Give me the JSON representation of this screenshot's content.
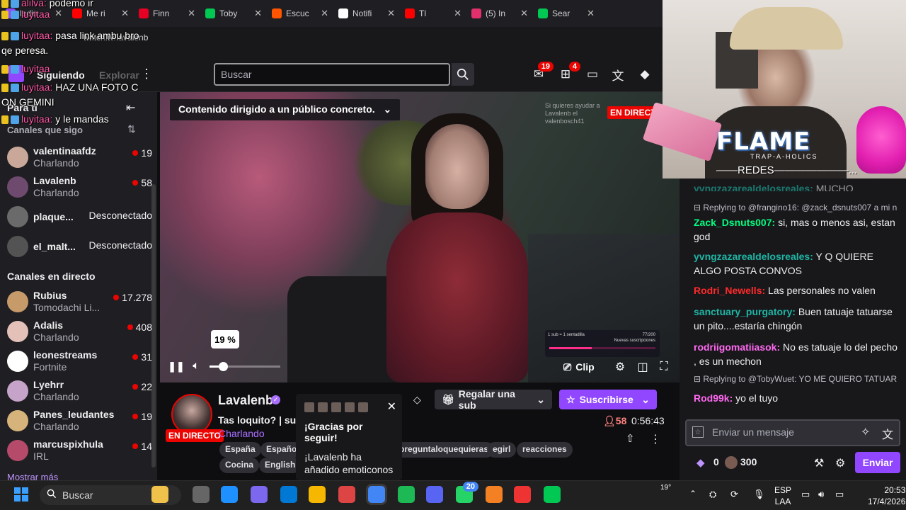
{
  "browser": {
    "tabs": [
      {
        "label": "ladin",
        "color": "#9147ff"
      },
      {
        "label": "Me ri",
        "color": "#ff0000"
      },
      {
        "label": "Finn",
        "color": "#e60023"
      },
      {
        "label": "Toby",
        "color": "#00c853"
      },
      {
        "label": "Escuc",
        "color": "#ff5500"
      },
      {
        "label": "Notifi",
        "color": "#ffffff"
      },
      {
        "label": "Tl",
        "color": "#ff0000"
      },
      {
        "label": "(5) In",
        "color": "#e1306c"
      },
      {
        "label": "Sear",
        "color": "#00c853"
      }
    ],
    "address": "twitch.tv/lavalenb"
  },
  "header": {
    "search_placeholder": "Buscar",
    "notifications_count": "19",
    "inbox_count": "4",
    "following_label": "Siguiendo",
    "browse_label": "Explorar"
  },
  "overlay_chat": [
    {
      "user": "alilva:",
      "text": "podemo ir"
    },
    {
      "user": "luyitaa",
      "text": ""
    },
    {
      "user": "luyitaa:",
      "text": "pasa link ambu bro"
    },
    {
      "user": "",
      "text": "qe peresa."
    },
    {
      "user": "luyitaa",
      "text": ""
    },
    {
      "user": "luyitaa:",
      "text": "HAZ UNA FOTO C"
    },
    {
      "user": "",
      "text": "ON GEMINI"
    },
    {
      "user": "luyitaa:",
      "text": "y le mandas"
    }
  ],
  "sidebar": {
    "for_you": "Para ti",
    "followed_title": "Canales que sigo",
    "followed": [
      {
        "name": "valentinaafdz",
        "sub": "Charlando",
        "viewers": "19",
        "online": true
      },
      {
        "name": "Lavalenb",
        "sub": "Charlando",
        "viewers": "58",
        "online": true
      },
      {
        "name": "plaque...",
        "sub": "",
        "status": "Desconectado",
        "online": false
      },
      {
        "name": "el_malt...",
        "sub": "",
        "status": "Desconectado",
        "online": false
      }
    ],
    "live_title": "Canales en directo",
    "live": [
      {
        "name": "Rubius",
        "sub": "Tomodachi Li...",
        "viewers": "17.278"
      },
      {
        "name": "Adalis",
        "sub": "Charlando",
        "viewers": "408"
      },
      {
        "name": "leonestreams",
        "sub": "Fortnite",
        "viewers": "31"
      },
      {
        "name": "Lyehrr",
        "sub": "Charlando",
        "viewers": "22"
      },
      {
        "name": "Panes_leudantes",
        "sub": "Charlando",
        "viewers": "19"
      },
      {
        "name": "marcuspixhula",
        "sub": "IRL",
        "viewers": "14"
      }
    ],
    "show_more": "Mostrar más"
  },
  "player": {
    "content_warning": "Contenido dirigido a un público concreto.",
    "live_label": "EN DIRECTO",
    "overlay_text": "Si quieres ayudar a Lavalenb el valenbosch41",
    "volume_percent": "19 %",
    "volume_level": 0.19,
    "clip_label": "Clip",
    "subgoal_text": "1 sub = 1 sentadilla",
    "subgoal_count": "77/200",
    "subgoal_label": "Nuevas suscripciones"
  },
  "stream": {
    "name": "Lavalenb",
    "live_badge": "EN DIRECTO",
    "title": "Tas loquito? | sul",
    "category": "Charlando",
    "tags": [
      "España",
      "Españo",
      "preguntaloquequieras",
      "egirl",
      "reacciones",
      "Cocina",
      "English"
    ],
    "gift_label": "Regalar una sub",
    "subscribe_label": "Suscribirse",
    "viewers": "58",
    "uptime": "0:56:43"
  },
  "follow_popup": {
    "title": "¡Gracias por seguir!",
    "text": "¡Lavalenb ha añadido emoticonos"
  },
  "webcam": {
    "flame": "FLAME",
    "flame_sub": "TRAP-A-HOLICS",
    "redes": "REDES"
  },
  "chat": {
    "messages": [
      {
        "reply": "",
        "user": "yvngzazarealdelosreales:",
        "color": "#1fb5a4",
        "text": "MUCHO"
      },
      {
        "reply": "Replying to @frangino16: @zack_dsnuts007 a mi n",
        "user": "",
        "color": "",
        "text": ""
      },
      {
        "reply": "",
        "user": "Zack_Dsnuts007:",
        "color": "#00ff7f",
        "text": "si, mas o menos asi, estan god"
      },
      {
        "reply": "",
        "user": "yvngzazarealdelosreales:",
        "color": "#1fb5a4",
        "text": "Y Q QUIERE ALGO POSTA CONVOS"
      },
      {
        "reply": "",
        "user": "Rodri_Newells:",
        "color": "#ff2a2a",
        "text": "Las personales no valen"
      },
      {
        "reply": "",
        "user": "sanctuary_purgatory:",
        "color": "#1fb5a4",
        "text": "Buen tatuaje tatuarse un pito....estaría chingón"
      },
      {
        "reply": "",
        "user": "rodriigomatiiasok:",
        "color": "#ff69f0",
        "text": "No es tatuaje lo del pecho , es un mechon"
      },
      {
        "reply": "Replying to @TobyWuet: YO ME QUIERO TATUAR",
        "user": "",
        "color": "",
        "text": ""
      },
      {
        "reply": "",
        "user": "Rod99k:",
        "color": "#ff69f0",
        "text": "yo el tuyo"
      }
    ],
    "input_placeholder": "Enviar un mensaje",
    "points_zero": "0",
    "points": "300",
    "send_label": "Enviar"
  },
  "taskbar": {
    "search_placeholder": "Buscar",
    "temperature": "19°",
    "lang_line1": "ESP",
    "lang_line2": "LAA",
    "time": "20:53",
    "date": "17/4/2026",
    "whatsapp_badge": "20"
  }
}
